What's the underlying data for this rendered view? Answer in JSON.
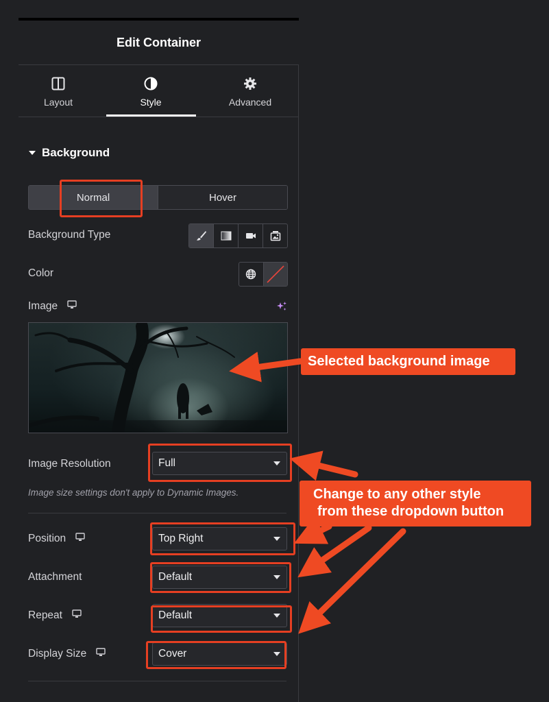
{
  "header": {
    "title": "Edit Container"
  },
  "tabs": [
    {
      "label": "Layout",
      "icon": "layout-icon"
    },
    {
      "label": "Style",
      "icon": "half-circle-icon",
      "active": true
    },
    {
      "label": "Advanced",
      "icon": "gear-icon"
    }
  ],
  "section": {
    "title": "Background"
  },
  "state_toggle": {
    "normal": "Normal",
    "hover": "Hover",
    "selected": "Normal"
  },
  "controls": {
    "background_type": {
      "label": "Background Type",
      "options": [
        "brush-icon",
        "gradient-icon",
        "video-icon",
        "slideshow-icon"
      ],
      "selected": "brush-icon"
    },
    "color": {
      "label": "Color"
    },
    "image": {
      "label": "Image"
    },
    "image_resolution": {
      "label": "Image Resolution",
      "value": "Full",
      "note": "Image size settings don't apply to Dynamic Images."
    },
    "position": {
      "label": "Position",
      "value": "Top Right"
    },
    "attachment": {
      "label": "Attachment",
      "value": "Default"
    },
    "repeat": {
      "label": "Repeat",
      "value": "Default"
    },
    "display_size": {
      "label": "Display Size",
      "value": "Cover"
    }
  },
  "annotations": {
    "callout_1": "Selected background image",
    "callout_2_line1": "Change to any other style",
    "callout_2_line2": "from these dropdown button"
  },
  "colors": {
    "panel_bg": "#202124",
    "annotation": "#ef4a23",
    "active_tab_underline": "#ffffff"
  }
}
